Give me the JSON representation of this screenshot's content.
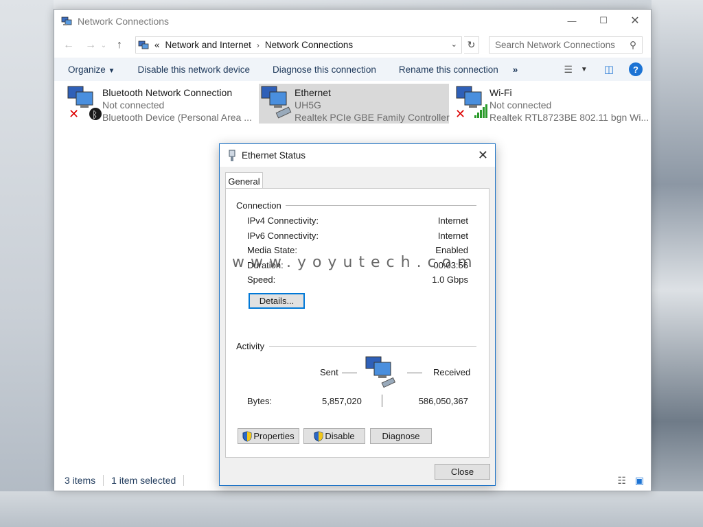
{
  "window": {
    "title": "Network Connections",
    "controls": {
      "minimize": "—",
      "maximize": "☐",
      "close": "✕"
    }
  },
  "address": {
    "prefix": "«",
    "crumbs": [
      "Network and Internet",
      "Network Connections"
    ],
    "search_placeholder": "Search Network Connections"
  },
  "toolbar": {
    "organize": "Organize",
    "disable": "Disable this network device",
    "diagnose": "Diagnose this connection",
    "rename": "Rename this connection",
    "more": "»",
    "help": "?"
  },
  "connections": [
    {
      "name": "Bluetooth Network Connection",
      "status": "Not connected",
      "device": "Bluetooth Device (Personal Area ..."
    },
    {
      "name": "Ethernet",
      "status": "UH5G",
      "device": "Realtek PCIe GBE Family Controller"
    },
    {
      "name": "Wi-Fi",
      "status": "Not connected",
      "device": "Realtek RTL8723BE 802.11 bgn Wi..."
    }
  ],
  "status_bar": {
    "count": "3 items",
    "selected": "1 item selected"
  },
  "dialog": {
    "title": "Ethernet Status",
    "tab": "General",
    "connection_label": "Connection",
    "rows": [
      {
        "label": "IPv4 Connectivity:",
        "value": "Internet"
      },
      {
        "label": "IPv6 Connectivity:",
        "value": "Internet"
      },
      {
        "label": "Media State:",
        "value": "Enabled"
      },
      {
        "label": "Duration:",
        "value": "00:03:56"
      },
      {
        "label": "Speed:",
        "value": "1.0 Gbps"
      }
    ],
    "details_button": "Details...",
    "activity_label": "Activity",
    "sent_label": "Sent",
    "received_label": "Received",
    "bytes_label": "Bytes:",
    "bytes_sent": "5,857,020",
    "bytes_received": "586,050,367",
    "properties_button": "Properties",
    "disable_button": "Disable",
    "diagnose_button": "Diagnose",
    "close_button": "Close"
  },
  "watermark": "www.yoyutech.com",
  "colors": {
    "accent": "#1f74c7",
    "link": "#1e395b",
    "help": "#1c73d4"
  }
}
